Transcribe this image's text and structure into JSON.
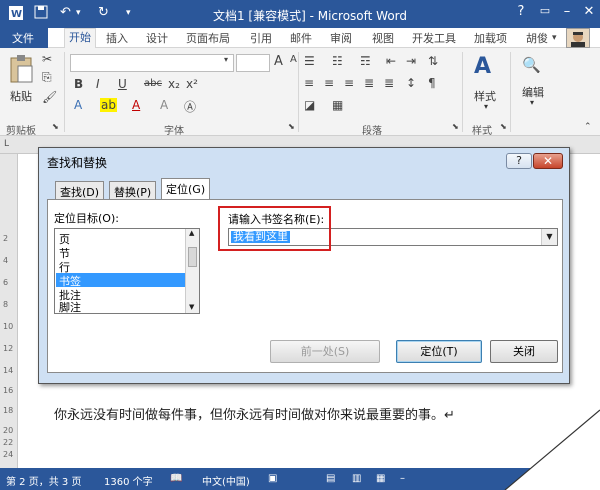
{
  "window": {
    "title": "文档1 [兼容模式] - Microsoft Word"
  },
  "menu_tabs": [
    "文件",
    "开始",
    "插入",
    "设计",
    "页面布局",
    "引用",
    "邮件",
    "审阅",
    "视图",
    "开发工具",
    "加载项"
  ],
  "user": "胡俊",
  "ribbon": {
    "paste_label": "粘贴",
    "clipboard_group": "剪贴板",
    "font_group": "字体",
    "paragraph_group": "段落",
    "styles_group": "样式",
    "styles_label": "样式",
    "edit_label": "编辑",
    "font_size_glyph": "A",
    "bold": "B",
    "italic": "I",
    "underline": "U",
    "strike": "abc",
    "sub": "x₂",
    "sup": "x²",
    "font_color": "A",
    "highlight": "ab",
    "text_effects": "A",
    "clear_format": "A"
  },
  "dialog": {
    "title": "查找和替换",
    "help": "?",
    "close": "✕",
    "tabs": [
      "查找(D)",
      "替换(P)",
      "定位(G)"
    ],
    "target_label": "定位目标(O):",
    "target_items": [
      "页",
      "节",
      "行",
      "书签",
      "批注",
      "脚注"
    ],
    "selected_item": "书签",
    "bookmark_label": "请输入书签名称(E):",
    "bookmark_value": "我看到这里",
    "prev_button": "前一处(S)",
    "goto_button": "定位(T)",
    "close_button": "关闭"
  },
  "document": {
    "body_text": "你永远没有时间做每件事，但你永远有时间做对你来说最重要的事。↵"
  },
  "ruler_marks": [
    "2",
    "4",
    "6",
    "8",
    "10",
    "12",
    "14",
    "16",
    "18",
    "20",
    "22",
    "24"
  ],
  "status": {
    "page": "第 2 页，共 3 页",
    "words": "1360 个字",
    "lang": "中文(中国)"
  },
  "colors": {
    "word_blue": "#2b579a",
    "highlight_red": "#d42020",
    "selection_blue": "#3399ff"
  }
}
